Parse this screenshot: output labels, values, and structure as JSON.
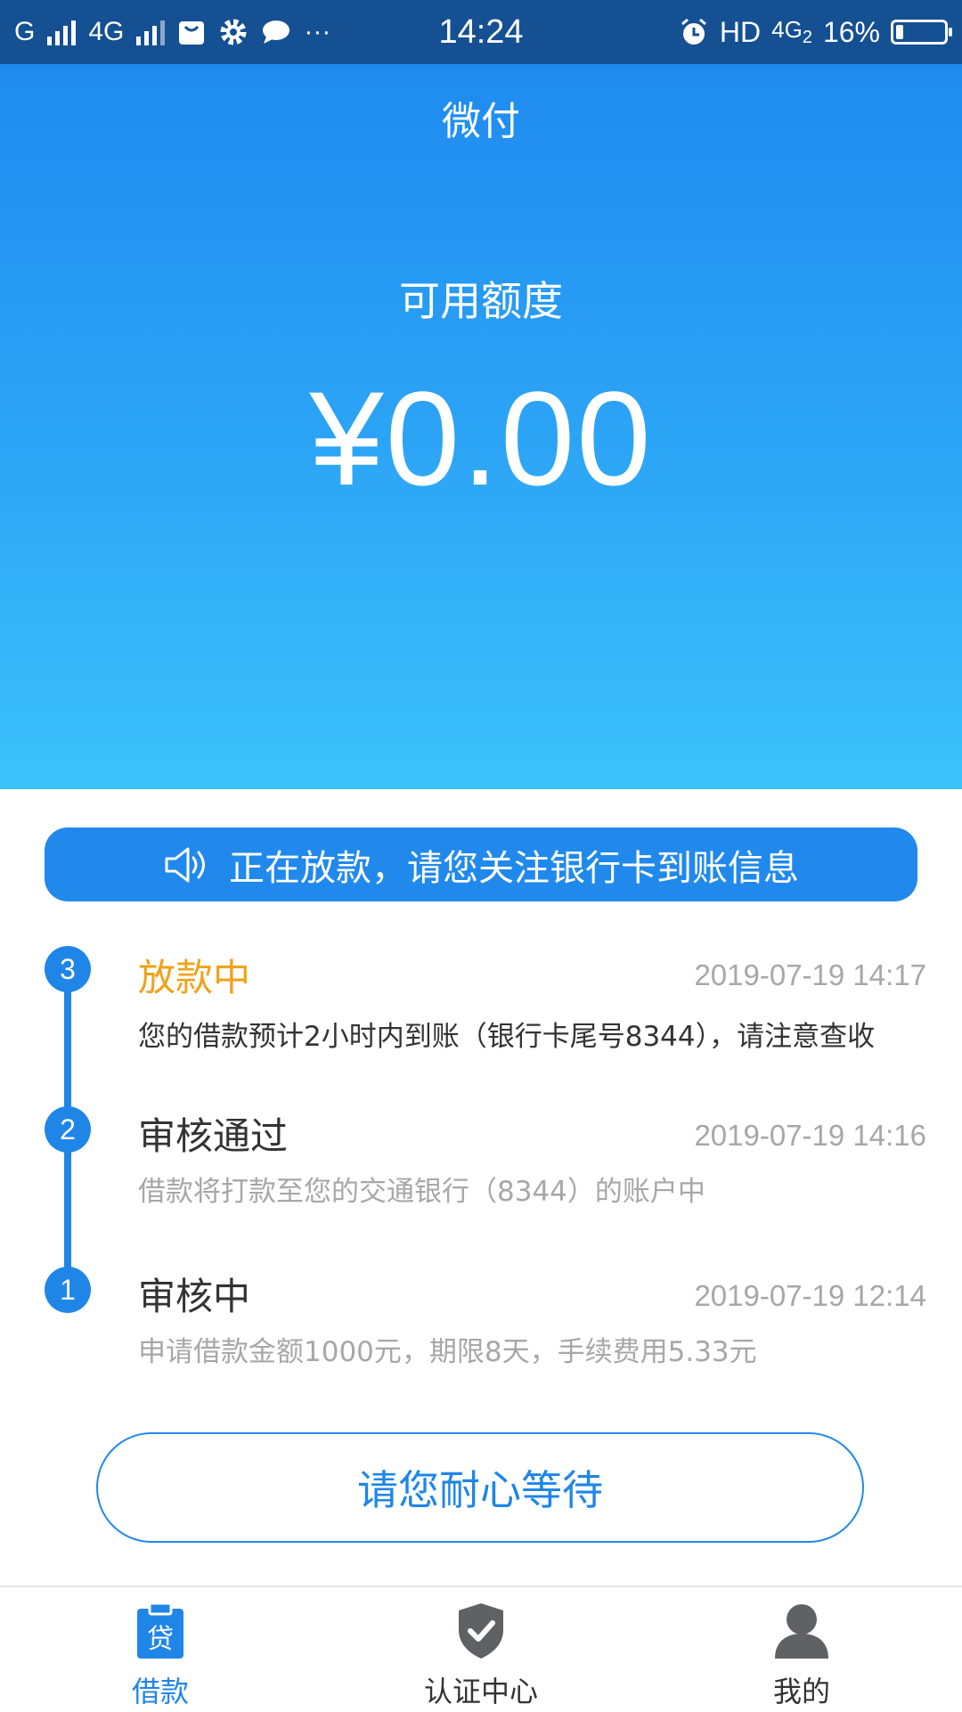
{
  "status_bar": {
    "carrier1": "G",
    "carrier2": "4G",
    "more": "···",
    "time": "14:24",
    "hd": "HD",
    "network": "4G",
    "network_sub": "2",
    "battery": "16%",
    "battery_level": 0.16
  },
  "header": {
    "app_title": "微付",
    "credit_label": "可用额度",
    "credit_amount": "¥0.00"
  },
  "notice": {
    "icon": "speaker-icon",
    "text": "正在放款，请您关注银行卡到账信息"
  },
  "timeline": {
    "steps": [
      {
        "number": "3",
        "title": "放款中",
        "time": "2019-07-19 14:17",
        "desc": "您的借款预计2小时内到账（银行卡尾号8344），请注意查收"
      },
      {
        "number": "2",
        "title": "审核通过",
        "time": "2019-07-19 14:16",
        "desc": "借款将打款至您的交通银行（8344）的账户中"
      },
      {
        "number": "1",
        "title": "审核中",
        "time": "2019-07-19 12:14",
        "desc": "申请借款金额1000元，期限8天，手续费用5.33元"
      }
    ]
  },
  "wait_button": "请您耐心等待",
  "bottom_nav": {
    "items": [
      {
        "label": "借款",
        "icon": "loan-icon",
        "badge": "贷"
      },
      {
        "label": "认证中心",
        "icon": "shield-check-icon"
      },
      {
        "label": "我的",
        "icon": "user-icon"
      }
    ]
  },
  "colors": {
    "primary": "#1f86e8",
    "active_step": "#f0a21a",
    "status_bar": "#145092"
  }
}
